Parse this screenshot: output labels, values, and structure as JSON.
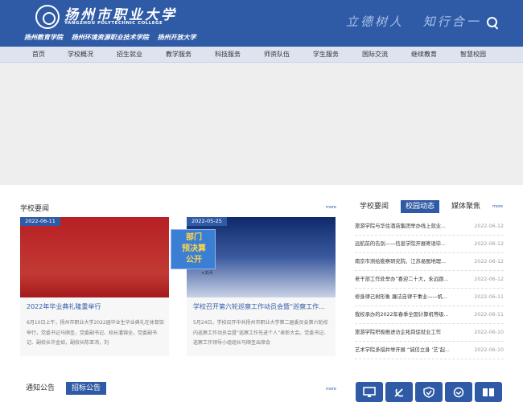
{
  "header": {
    "school_name": "扬州市职业大学",
    "school_name_en": "YANGZHOU POLYTECHNIC COLLEGE",
    "sub_names": [
      "扬州教育学院",
      "扬州环境资源职业技术学院",
      "扬州开放大学"
    ],
    "slogan": [
      "立德树人",
      "知行合一"
    ]
  },
  "nav": [
    "首页",
    "学校概况",
    "招生就业",
    "教学服务",
    "科技服务",
    "师资队伍",
    "学生服务",
    "国际交流",
    "继续教育",
    "智慧校园"
  ],
  "school_news": {
    "title": "学校要闻",
    "more": "more",
    "cards": [
      {
        "date": "2022-06-11",
        "title": "2022年毕业典礼隆重举行",
        "text": "6月10日上午，扬州市职业大学2022届毕业生毕业典礼在体育馆举行，党委书记马顺圣，党委副书记、校长潘锦全，党委副书记、副校长许金如，副校长陈亚鸿，刘"
      },
      {
        "date": "2022-05-25",
        "title": "学校召开第六轮巡察工作动员会暨“巡察工作...",
        "text": "5月24日，学校召开中共扬州市职业大学第二届委员会第六轮校内巡察工作动员会暨“巡察工作先进个人”表彰大会。党委书记、巡察工作领导小组组长马顺圣出席会"
      }
    ]
  },
  "float_ad": {
    "lines": [
      "部门",
      "预决算",
      "公开"
    ],
    "close": "×关闭"
  },
  "right_panel": {
    "tabs": [
      "学校要闻",
      "校园动态",
      "媒体聚焦"
    ],
    "active_tab": "校园动态",
    "more": "more",
    "items": [
      {
        "title": "旅游学院与华住酒店集团举办线上就业...",
        "date": "2022-06-12"
      },
      {
        "title": "远航前的告别——信息学院开展寄语毕...",
        "date": "2022-06-12"
      },
      {
        "title": "南京市测绘勘察研究院、江苏易图地理...",
        "date": "2022-06-12"
      },
      {
        "title": "老干部工作处举办“喜迎二十大，永远跟...",
        "date": "2022-06-12"
      },
      {
        "title": "修身律己树形象 廉洁自律干事业——机...",
        "date": "2022-06-11"
      },
      {
        "title": "我校承办的2022年春季全国计算机等级...",
        "date": "2022-06-11"
      },
      {
        "title": "旅游学院积极推进访企拓岗促就业工作",
        "date": "2022-06-10"
      },
      {
        "title": "艺术学院多措并举开展 “诚信立身 ‘艺’起...",
        "date": "2022-06-10"
      }
    ]
  },
  "notice": {
    "tabs": [
      "通知公告",
      "招标公告"
    ],
    "more": "more"
  },
  "colors": {
    "primary": "#2f5aa6",
    "nav_bg": "#dde4ef",
    "banner_bg": "#eeeeee"
  },
  "quick_icons": [
    "monitor-icon",
    "party-icon",
    "shield-icon",
    "handshake-icon",
    "book-icon"
  ]
}
